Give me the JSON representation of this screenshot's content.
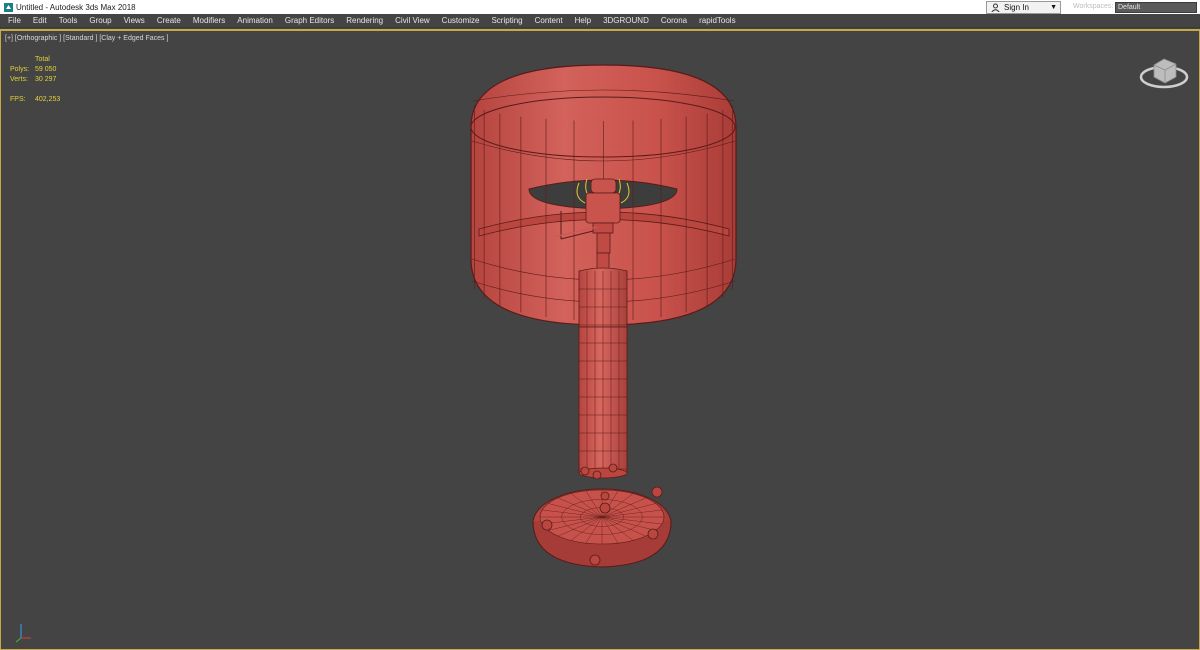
{
  "window": {
    "title": "Untitled - Autodesk 3ds Max 2018",
    "icon": "3dsmax-app-icon",
    "controls": {
      "minimize": "—",
      "restore": "❐",
      "close": "✕"
    }
  },
  "menu": {
    "items": [
      "File",
      "Edit",
      "Tools",
      "Group",
      "Views",
      "Create",
      "Modifiers",
      "Animation",
      "Graph Editors",
      "Rendering",
      "Civil View",
      "Customize",
      "Scripting",
      "Content",
      "Help",
      "3DGROUND",
      "Corona",
      "rapidTools"
    ],
    "sign_in": "Sign In",
    "workspaces_label": "Workspaces:",
    "workspaces_value": "Default"
  },
  "viewport": {
    "label": "[+] [Orthographic ] [Standard ] [Clay + Edged Faces ]",
    "stats": {
      "total_label": "Total",
      "polys_label": "Polys:",
      "polys_value": "59 050",
      "verts_label": "Verts:",
      "verts_value": "30 297",
      "fps_label": "FPS:",
      "fps_value": "402,253"
    }
  },
  "colors": {
    "viewport_bg": "#444444",
    "active_border": "#c7a94a",
    "stats_text": "#e3d13a",
    "clay_fill": "#c8534d",
    "wire": "#5a1b18"
  }
}
